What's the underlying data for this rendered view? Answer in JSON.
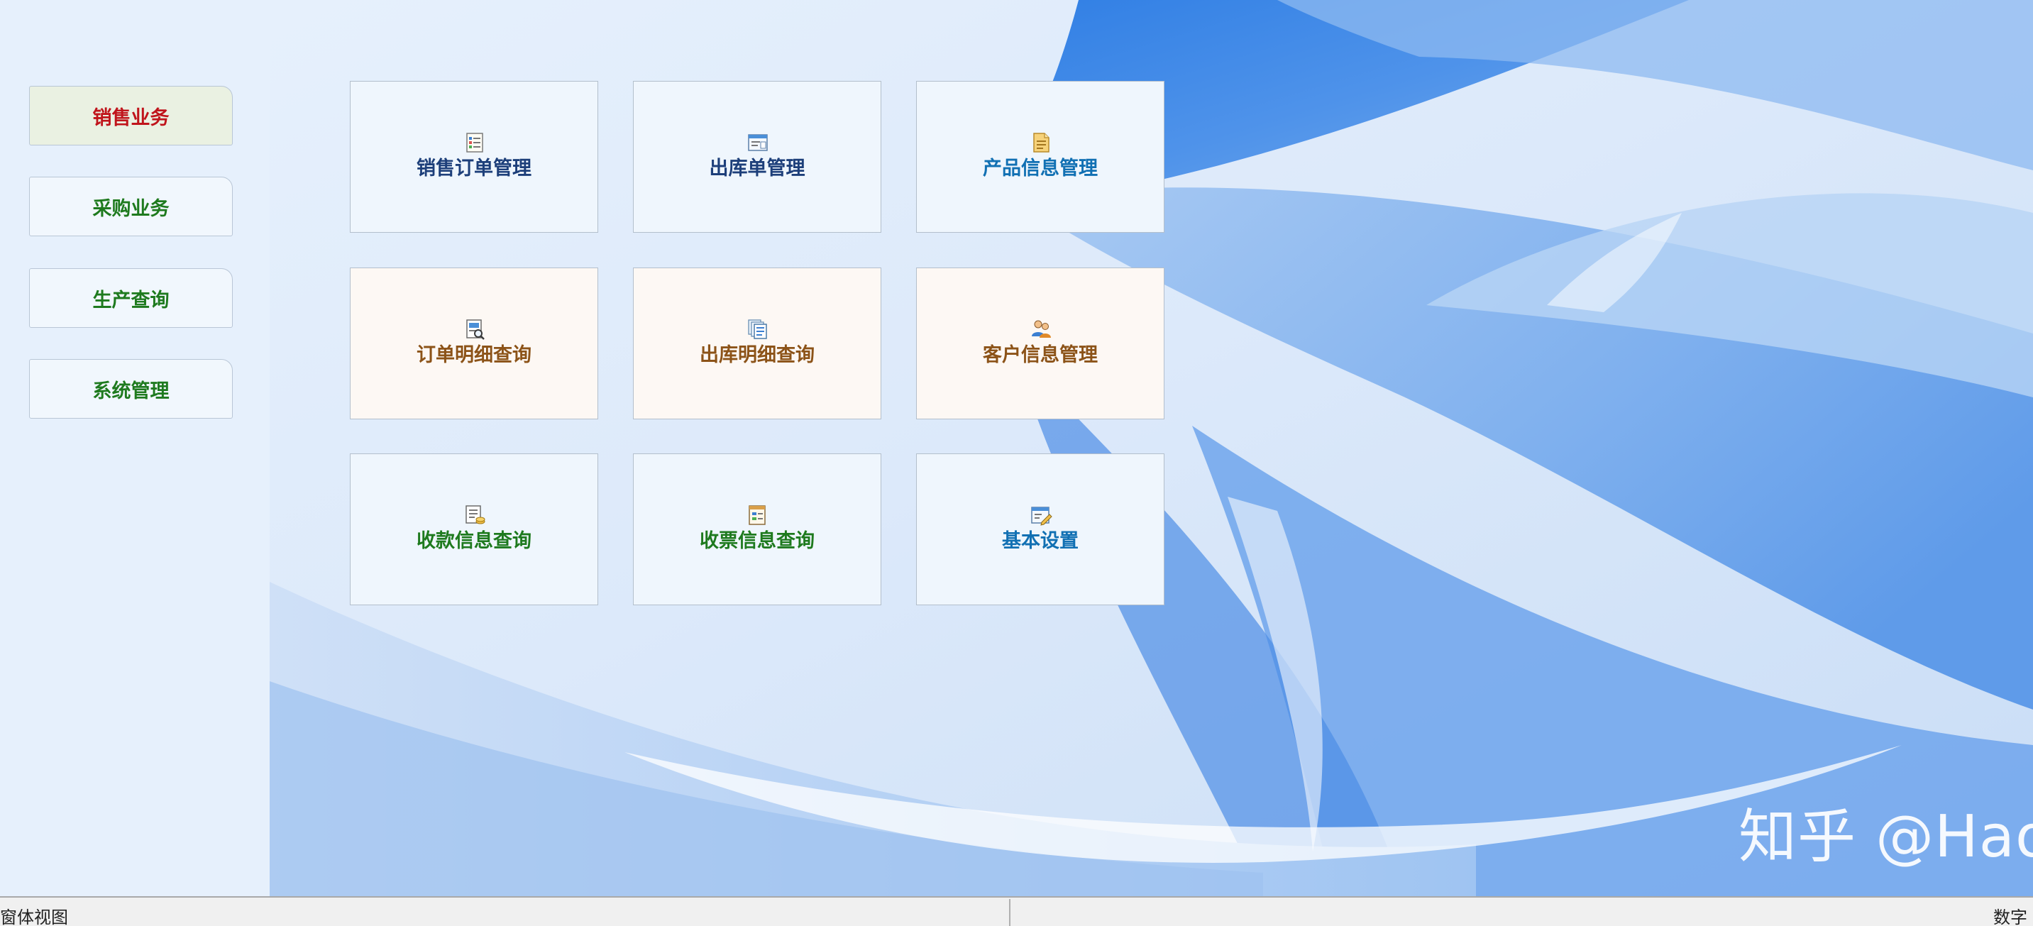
{
  "sidebar": {
    "items": [
      {
        "label": "销售业务",
        "active": true
      },
      {
        "label": "采购业务",
        "active": false
      },
      {
        "label": "生产查询",
        "active": false
      },
      {
        "label": "系统管理",
        "active": false
      }
    ]
  },
  "tiles": [
    {
      "label": "销售订单管理",
      "icon": "list-document-icon",
      "color": "#1d3f7a"
    },
    {
      "label": "出库单管理",
      "icon": "window-form-icon",
      "color": "#1d3f7a"
    },
    {
      "label": "产品信息管理",
      "icon": "note-document-icon",
      "color": "#1170b3"
    },
    {
      "label": "订单明细查询",
      "icon": "document-search-icon",
      "color": "#8c5318"
    },
    {
      "label": "出库明细查询",
      "icon": "stacked-documents-icon",
      "color": "#8c5318"
    },
    {
      "label": "客户信息管理",
      "icon": "users-group-icon",
      "color": "#8c5318"
    },
    {
      "label": "收款信息查询",
      "icon": "document-coins-icon",
      "color": "#1e7a1e"
    },
    {
      "label": "收票信息查询",
      "icon": "receipt-form-icon",
      "color": "#1e7a1e"
    },
    {
      "label": "基本设置",
      "icon": "edit-settings-icon",
      "color": "#1170b3"
    }
  ],
  "watermark": "知乎 @HaoHualee",
  "statusbar": {
    "left_text": "窗体视图",
    "right_text": "数字"
  },
  "colors": {
    "active_nav_text": "#c0141b",
    "nav_text": "#1e7a1e",
    "background_blue": "#3f8ae6"
  }
}
